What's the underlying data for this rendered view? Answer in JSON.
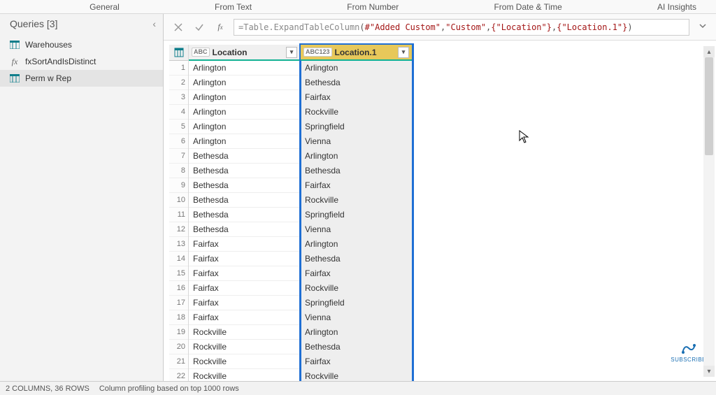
{
  "ribbon": {
    "tabs": [
      "General",
      "From Text",
      "From Number",
      "From Date & Time",
      "AI Insights"
    ]
  },
  "queries": {
    "title": "Queries [3]",
    "items": [
      {
        "label": "Warehouses",
        "icon": "table"
      },
      {
        "label": "fxSortAndIsDistinct",
        "icon": "fx"
      },
      {
        "label": "Perm w Rep",
        "icon": "table",
        "selected": true
      }
    ]
  },
  "formula": {
    "prefix": "= ",
    "fn": "Table.ExpandTableColumn",
    "args_display": [
      "#\"Added Custom\"",
      "\"Custom\"",
      "{\"Location\"}",
      "{\"Location.1\"}"
    ]
  },
  "columns": [
    {
      "name": "Location",
      "type_label": "ABC",
      "selected": false
    },
    {
      "name": "Location.1",
      "type_label": "ABC123",
      "selected": true
    }
  ],
  "rows": [
    {
      "n": 1,
      "c0": "Arlington",
      "c1": "Arlington"
    },
    {
      "n": 2,
      "c0": "Arlington",
      "c1": "Bethesda"
    },
    {
      "n": 3,
      "c0": "Arlington",
      "c1": "Fairfax"
    },
    {
      "n": 4,
      "c0": "Arlington",
      "c1": "Rockville"
    },
    {
      "n": 5,
      "c0": "Arlington",
      "c1": "Springfield"
    },
    {
      "n": 6,
      "c0": "Arlington",
      "c1": "Vienna"
    },
    {
      "n": 7,
      "c0": "Bethesda",
      "c1": "Arlington"
    },
    {
      "n": 8,
      "c0": "Bethesda",
      "c1": "Bethesda"
    },
    {
      "n": 9,
      "c0": "Bethesda",
      "c1": "Fairfax"
    },
    {
      "n": 10,
      "c0": "Bethesda",
      "c1": "Rockville"
    },
    {
      "n": 11,
      "c0": "Bethesda",
      "c1": "Springfield"
    },
    {
      "n": 12,
      "c0": "Bethesda",
      "c1": "Vienna"
    },
    {
      "n": 13,
      "c0": "Fairfax",
      "c1": "Arlington"
    },
    {
      "n": 14,
      "c0": "Fairfax",
      "c1": "Bethesda"
    },
    {
      "n": 15,
      "c0": "Fairfax",
      "c1": "Fairfax"
    },
    {
      "n": 16,
      "c0": "Fairfax",
      "c1": "Rockville"
    },
    {
      "n": 17,
      "c0": "Fairfax",
      "c1": "Springfield"
    },
    {
      "n": 18,
      "c0": "Fairfax",
      "c1": "Vienna"
    },
    {
      "n": 19,
      "c0": "Rockville",
      "c1": "Arlington"
    },
    {
      "n": 20,
      "c0": "Rockville",
      "c1": "Bethesda"
    },
    {
      "n": 21,
      "c0": "Rockville",
      "c1": "Fairfax"
    },
    {
      "n": 22,
      "c0": "Rockville",
      "c1": "Rockville"
    }
  ],
  "status": {
    "cols_rows": "2 COLUMNS, 36 ROWS",
    "profiling": "Column profiling based on top 1000 rows"
  },
  "subscribe_label": "SUBSCRIBE"
}
